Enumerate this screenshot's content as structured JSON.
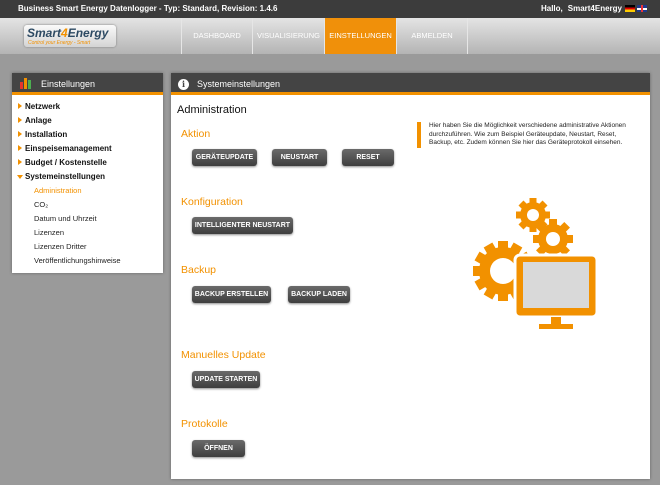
{
  "topbar": {
    "title": "Business Smart Energy Datenlogger - Typ: Standard, Revision: 1.4.6",
    "greeting": "Hallo,",
    "user": "Smart4Energy"
  },
  "logo": {
    "brand_a": "Smart",
    "brand_four": "4",
    "brand_b": "Energy",
    "tagline": "Control your Energy - Smart"
  },
  "nav": {
    "items": [
      {
        "label": "DASHBOARD"
      },
      {
        "label": "VISUALISIERUNG"
      },
      {
        "label": "EINSTELLUNGEN"
      },
      {
        "label": "ABMELDEN"
      }
    ],
    "active_index": 2
  },
  "sidebar": {
    "title": "Einstellungen",
    "menu": [
      {
        "label": "Netzwerk"
      },
      {
        "label": "Anlage"
      },
      {
        "label": "Installation"
      },
      {
        "label": "Einspeisemanagement"
      },
      {
        "label": "Budget / Kostenstelle"
      },
      {
        "label": "Systemeinstellungen"
      }
    ],
    "submenu": [
      {
        "label": "Administration"
      },
      {
        "label": "CO₂"
      },
      {
        "label": "Datum und Uhrzeit"
      },
      {
        "label": "Lizenzen"
      },
      {
        "label": "Lizenzen Dritter"
      },
      {
        "label": "Veröffentlichungshinweise"
      }
    ]
  },
  "main": {
    "header": "Systemeinstellungen",
    "page_title": "Administration",
    "help_text": "Hier haben Sie die Möglichkeit verschiedene administrative Aktionen durchzuführen. Wie zum Beispiel Geräteupdate, Neustart, Reset, Backup, etc. Zudem können Sie hier das Geräteprotokoll einsehen.",
    "sections": {
      "aktion": {
        "title": "Aktion",
        "buttons": [
          "GERÄTEUPDATE",
          "NEUSTART",
          "RESET"
        ]
      },
      "konfiguration": {
        "title": "Konfiguration",
        "buttons": [
          "INTELLIGENTER NEUSTART"
        ]
      },
      "backup": {
        "title": "Backup",
        "buttons": [
          "BACKUP ERSTELLEN",
          "BACKUP LADEN"
        ]
      },
      "update": {
        "title": "Manuelles Update",
        "buttons": [
          "UPDATE STARTEN"
        ]
      },
      "protokolle": {
        "title": "Protokolle",
        "buttons": [
          "ÖFFNEN"
        ]
      }
    }
  },
  "colors": {
    "accent": "#f29100",
    "dark_header": "#444444",
    "topbar": "#3c3c3c"
  },
  "icons": {
    "sidebar_header": "bar-chart-icon",
    "main_header": "info-icon",
    "illustration": "gears-monitor-icon"
  }
}
